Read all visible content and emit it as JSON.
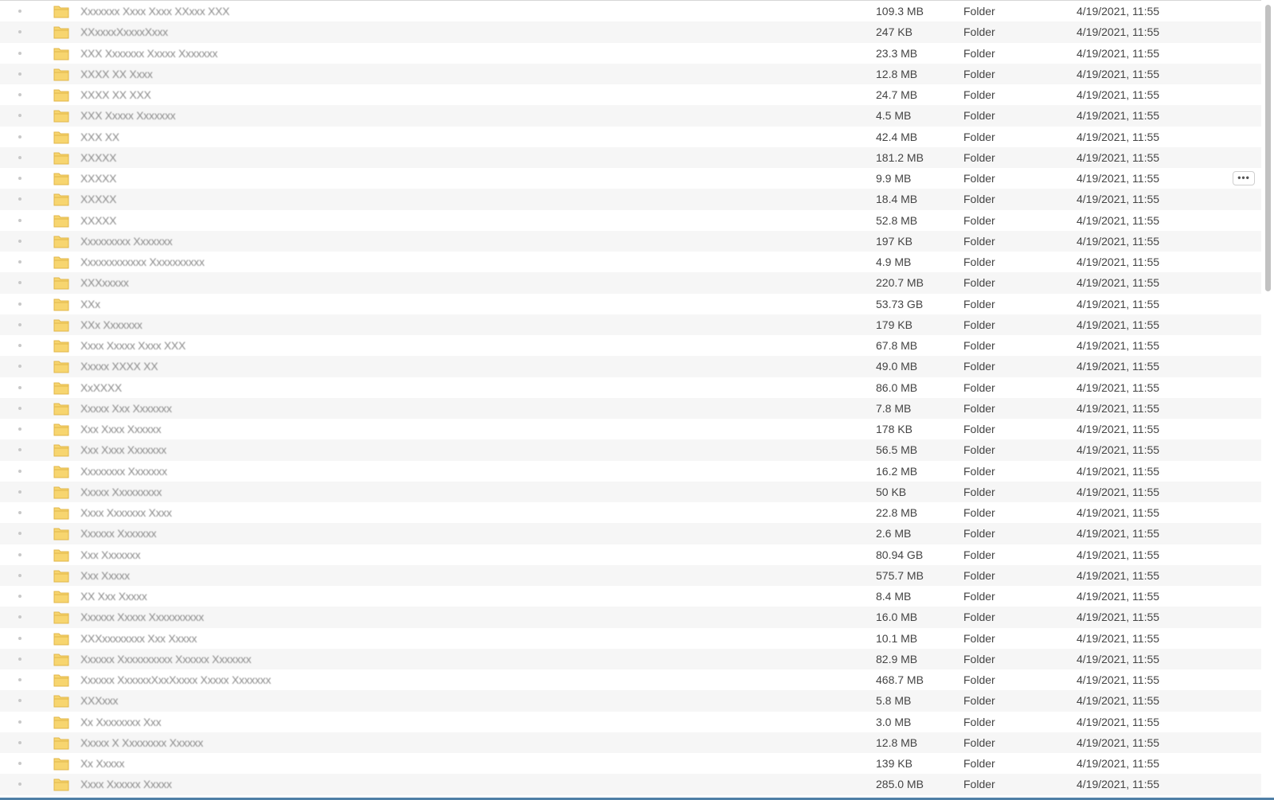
{
  "colors": {
    "folder_fill": "#f7d56f",
    "folder_stroke": "#e0b64a",
    "accent_marker": "#e26f75",
    "bottom_bar": "#4f7fa6"
  },
  "icons": {
    "folder": "folder-icon",
    "more": "more-icon"
  },
  "file_list": {
    "rows": [
      {
        "name": "Xxxxxxx Xxxx Xxxx XXxxx XXX",
        "size": "109.3 MB",
        "kind": "Folder",
        "modified": "4/19/2021, 11:55"
      },
      {
        "name": "XXxxxxXxxxxXxxx",
        "size": "247 KB",
        "kind": "Folder",
        "modified": "4/19/2021, 11:55"
      },
      {
        "name": "XXX Xxxxxxx Xxxxx Xxxxxxx",
        "size": "23.3 MB",
        "kind": "Folder",
        "modified": "4/19/2021, 11:55"
      },
      {
        "name": "XXXX XX Xxxx",
        "size": "12.8 MB",
        "kind": "Folder",
        "modified": "4/19/2021, 11:55"
      },
      {
        "name": "XXXX XX XXX",
        "size": "24.7 MB",
        "kind": "Folder",
        "modified": "4/19/2021, 11:55"
      },
      {
        "name": "XXX Xxxxx Xxxxxxx",
        "size": "4.5 MB",
        "kind": "Folder",
        "modified": "4/19/2021, 11:55"
      },
      {
        "name": "XXX XX",
        "size": "42.4 MB",
        "kind": "Folder",
        "modified": "4/19/2021, 11:55"
      },
      {
        "name": "XXXXX",
        "size": "181.2 MB",
        "kind": "Folder",
        "modified": "4/19/2021, 11:55"
      },
      {
        "name": "XXXXX",
        "size": "9.9 MB",
        "kind": "Folder",
        "modified": "4/19/2021, 11:55"
      },
      {
        "name": "XXXXX",
        "size": "18.4 MB",
        "kind": "Folder",
        "modified": "4/19/2021, 11:55"
      },
      {
        "name": "XXXXX",
        "size": "52.8 MB",
        "kind": "Folder",
        "modified": "4/19/2021, 11:55"
      },
      {
        "name": "Xxxxxxxxx Xxxxxxx",
        "size": "197 KB",
        "kind": "Folder",
        "modified": "4/19/2021, 11:55"
      },
      {
        "name": "Xxxxxxxxxxxx Xxxxxxxxxx",
        "size": "4.9 MB",
        "kind": "Folder",
        "modified": "4/19/2021, 11:55"
      },
      {
        "name": "XXXxxxxx",
        "size": "220.7 MB",
        "kind": "Folder",
        "modified": "4/19/2021, 11:55"
      },
      {
        "name": "XXx",
        "size": "53.73 GB",
        "kind": "Folder",
        "modified": "4/19/2021, 11:55"
      },
      {
        "name": "XXx Xxxxxxx",
        "size": "179 KB",
        "kind": "Folder",
        "modified": "4/19/2021, 11:55"
      },
      {
        "name": "Xxxx Xxxxx Xxxx XXX",
        "size": "67.8 MB",
        "kind": "Folder",
        "modified": "4/19/2021, 11:55"
      },
      {
        "name": "Xxxxx XXXX XX",
        "size": "49.0 MB",
        "kind": "Folder",
        "modified": "4/19/2021, 11:55"
      },
      {
        "name": "XxXXXX",
        "size": "86.0 MB",
        "kind": "Folder",
        "modified": "4/19/2021, 11:55"
      },
      {
        "name": "Xxxxx Xxx Xxxxxxx",
        "size": "7.8 MB",
        "kind": "Folder",
        "modified": "4/19/2021, 11:55"
      },
      {
        "name": "Xxx Xxxx Xxxxxx",
        "size": "178 KB",
        "kind": "Folder",
        "modified": "4/19/2021, 11:55"
      },
      {
        "name": "Xxx Xxxx Xxxxxxx",
        "size": "56.5 MB",
        "kind": "Folder",
        "modified": "4/19/2021, 11:55"
      },
      {
        "name": "Xxxxxxxx Xxxxxxx",
        "size": "16.2 MB",
        "kind": "Folder",
        "modified": "4/19/2021, 11:55"
      },
      {
        "name": "Xxxxx Xxxxxxxxx",
        "size": "50 KB",
        "kind": "Folder",
        "modified": "4/19/2021, 11:55"
      },
      {
        "name": "Xxxx Xxxxxxx Xxxx",
        "size": "22.8 MB",
        "kind": "Folder",
        "modified": "4/19/2021, 11:55"
      },
      {
        "name": "Xxxxxx Xxxxxxx",
        "size": "2.6 MB",
        "kind": "Folder",
        "modified": "4/19/2021, 11:55"
      },
      {
        "name": "Xxx Xxxxxxx",
        "size": "80.94 GB",
        "kind": "Folder",
        "modified": "4/19/2021, 11:55"
      },
      {
        "name": "Xxx Xxxxx",
        "size": "575.7 MB",
        "kind": "Folder",
        "modified": "4/19/2021, 11:55"
      },
      {
        "name": "XX Xxx Xxxxx",
        "size": "8.4 MB",
        "kind": "Folder",
        "modified": "4/19/2021, 11:55"
      },
      {
        "name": "Xxxxxx Xxxxx Xxxxxxxxxx",
        "size": "16.0 MB",
        "kind": "Folder",
        "modified": "4/19/2021, 11:55"
      },
      {
        "name": "XXXxxxxxxxx Xxx Xxxxx",
        "size": "10.1 MB",
        "kind": "Folder",
        "modified": "4/19/2021, 11:55"
      },
      {
        "name": "Xxxxxx Xxxxxxxxxx Xxxxxx Xxxxxxx",
        "size": "82.9 MB",
        "kind": "Folder",
        "modified": "4/19/2021, 11:55"
      },
      {
        "name": "Xxxxxx XxxxxxXxxXxxxx Xxxxx Xxxxxxx",
        "size": "468.7 MB",
        "kind": "Folder",
        "modified": "4/19/2021, 11:55"
      },
      {
        "name": "XXXxxx",
        "size": "5.8 MB",
        "kind": "Folder",
        "modified": "4/19/2021, 11:55"
      },
      {
        "name": "Xx Xxxxxxxx Xxx",
        "size": "3.0 MB",
        "kind": "Folder",
        "modified": "4/19/2021, 11:55"
      },
      {
        "name": "Xxxxx X Xxxxxxxx Xxxxxx",
        "size": "12.8 MB",
        "kind": "Folder",
        "modified": "4/19/2021, 11:55"
      },
      {
        "name": "Xx Xxxxx",
        "size": "139 KB",
        "kind": "Folder",
        "modified": "4/19/2021, 11:55"
      },
      {
        "name": "Xxxx Xxxxxx Xxxxx",
        "size": "285.0 MB",
        "kind": "Folder",
        "modified": "4/19/2021, 11:55"
      }
    ],
    "more_label": "•••"
  }
}
